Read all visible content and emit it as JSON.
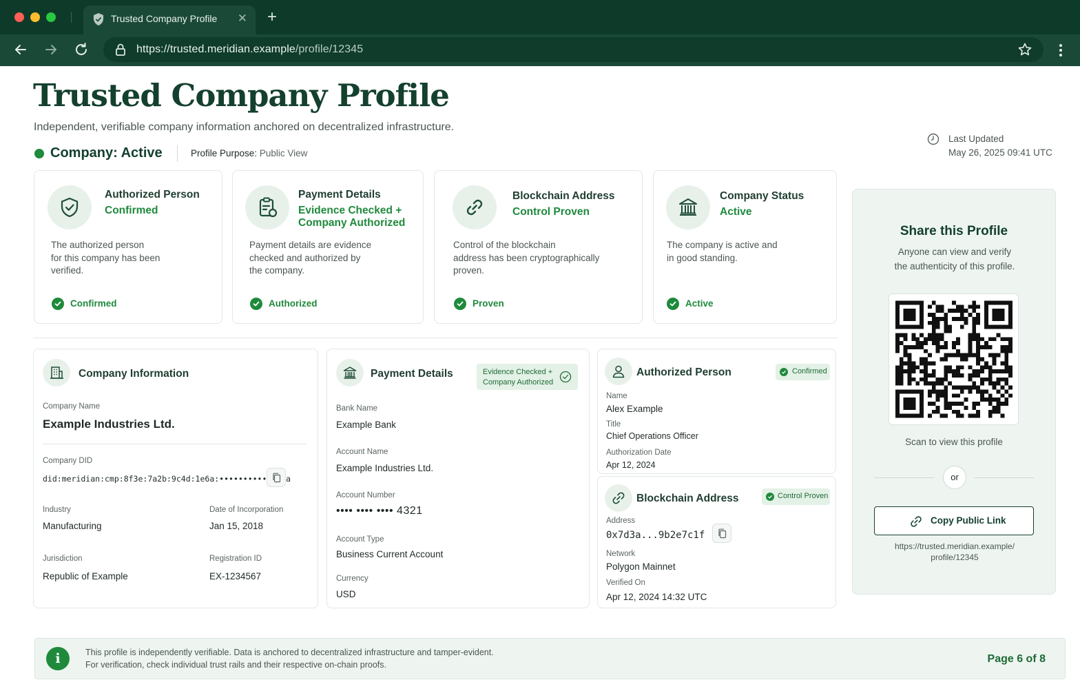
{
  "browser": {
    "tab_title": "Trusted Company Profile",
    "url_host": "https://trusted.meridian.example",
    "url_path": "/profile/12345"
  },
  "header": {
    "title": "Trusted Company Profile",
    "subtitle": "Independent, verifiable company information anchored on decentralized infrastructure.",
    "status": "Company: Active",
    "purpose_label": "Profile Purpose:",
    "purpose_value": "Public View",
    "last_updated_label": "Last Updated",
    "last_updated_value": "May 26, 2025 09:41 UTC"
  },
  "rails": [
    {
      "title": "Authorized Person",
      "status_line1": "Confirmed",
      "status_line2": "",
      "desc": [
        "The authorized person",
        "for this company has been",
        "verified."
      ],
      "badge": "Confirmed",
      "icon": "shield-check-icon"
    },
    {
      "title": "Payment Details",
      "status_line1": "Evidence Checked +",
      "status_line2": "Company Authorized",
      "desc": [
        "Payment details are evidence",
        "checked and authorized by",
        "the company."
      ],
      "badge": "Authorized",
      "icon": "clipboard-check-icon"
    },
    {
      "title": "Blockchain Address",
      "status_line1": "Control Proven",
      "status_line2": "",
      "desc": [
        "Control of the blockchain",
        "address has been cryptographically",
        "proven."
      ],
      "badge": "Proven",
      "icon": "link-icon"
    },
    {
      "title": "Company Status",
      "status_line1": "Active",
      "status_line2": "",
      "desc": [
        "The company is active and",
        "in good standing."
      ],
      "badge": "Active",
      "icon": "bank-icon"
    }
  ],
  "company": {
    "title": "Company Information",
    "name_label": "Company Name",
    "name_value": "Example Industries Ltd.",
    "did_label": "Company DID",
    "did_value": "did:meridian:cmp:8f3e:7a2b:9c4d:1e6a:•••••••••••3f7a",
    "industry_label": "Industry",
    "industry_value": "Manufacturing",
    "inc_label": "Date of Incorporation",
    "inc_value": "Jan 15, 2018",
    "jur_label": "Jurisdiction",
    "jur_value": "Republic of Example",
    "reg_label": "Registration ID",
    "reg_value": "EX-1234567"
  },
  "payment": {
    "title": "Payment Details",
    "badge_line1": "Evidence Checked +",
    "badge_line2": "Company Authorized",
    "bank_label": "Bank Name",
    "bank_value": "Example Bank",
    "acct_name_label": "Account Name",
    "acct_name_value": "Example Industries Ltd.",
    "acct_num_label": "Account Number",
    "acct_num_value": "•••• •••• •••• 4321",
    "acct_type_label": "Account Type",
    "acct_type_value": "Business Current Account",
    "currency_label": "Currency",
    "currency_value": "USD"
  },
  "person": {
    "title": "Authorized Person",
    "badge": "Confirmed",
    "name_label": "Name",
    "name_value": "Alex Example",
    "title_label": "Title",
    "title_value": "Chief Operations Officer",
    "date_label": "Authorization Date",
    "date_value": "Apr 12, 2024"
  },
  "blockchain": {
    "title": "Blockchain Address",
    "badge": "Control Proven",
    "addr_label": "Address",
    "addr_value": "0x7d3a...9b2e7c1f",
    "network_label": "Network",
    "network_value": "Polygon Mainnet",
    "verified_label": "Verified On",
    "verified_value": "Apr 12, 2024 14:32 UTC"
  },
  "share": {
    "title": "Share this Profile",
    "desc_line1": "Anyone can view and verify",
    "desc_line2": "the authenticity of this profile.",
    "scan": "Scan to view this profile",
    "or": "or",
    "copy_button": "Copy Public Link",
    "url_line1": "https://trusted.meridian.example/",
    "url_line2": "profile/12345"
  },
  "footer": {
    "note_line1": "This profile is independently verifiable. Data is anchored to decentralized infrastructure and tamper-evident.",
    "note_line2": "For verification, check individual trust rails and their respective on-chain proofs.",
    "page": "Page 6 of 8"
  },
  "colors": {
    "brand_dark": "#14402e",
    "accent_green": "#1f8a3c",
    "chrome": "#0e3a29"
  }
}
